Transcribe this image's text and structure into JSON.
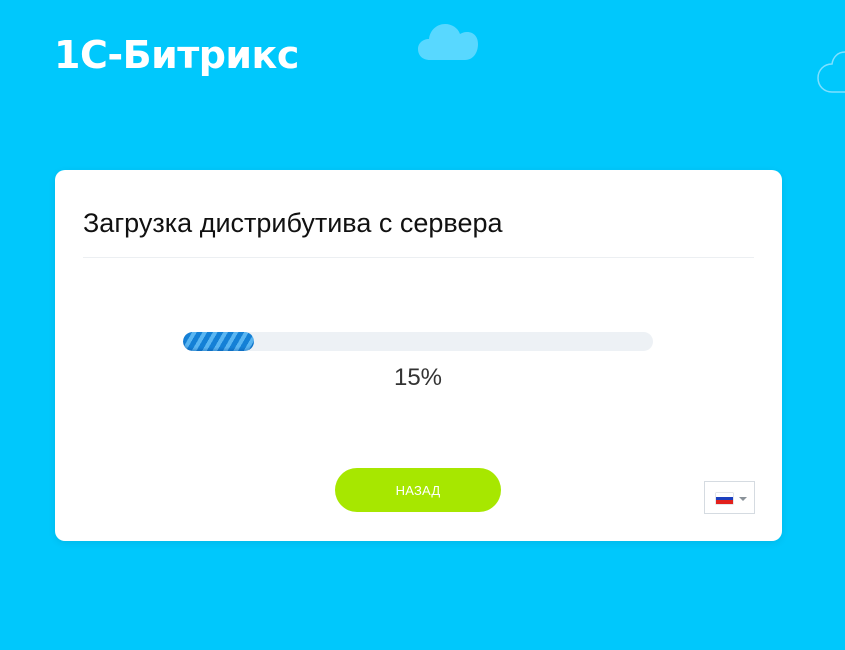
{
  "header": {
    "logo_text": "1С-Битрикс"
  },
  "decor": {
    "clouds": [
      "cloud-icon",
      "cloud-icon"
    ],
    "background_color": "#00c8fc",
    "cloud_color": "#58d8ff"
  },
  "card": {
    "title": "Загрузка дистрибутива с сервера",
    "progress": {
      "fraction": 0.15,
      "label": "15%"
    },
    "back_button_label": "НАЗАД",
    "language_select": {
      "selected": "ru",
      "icon": "russian-flag-icon"
    }
  },
  "colors": {
    "accent_button": "#a7e700",
    "progress_fill": "#1a8ee2",
    "progress_track": "#edf1f5"
  }
}
